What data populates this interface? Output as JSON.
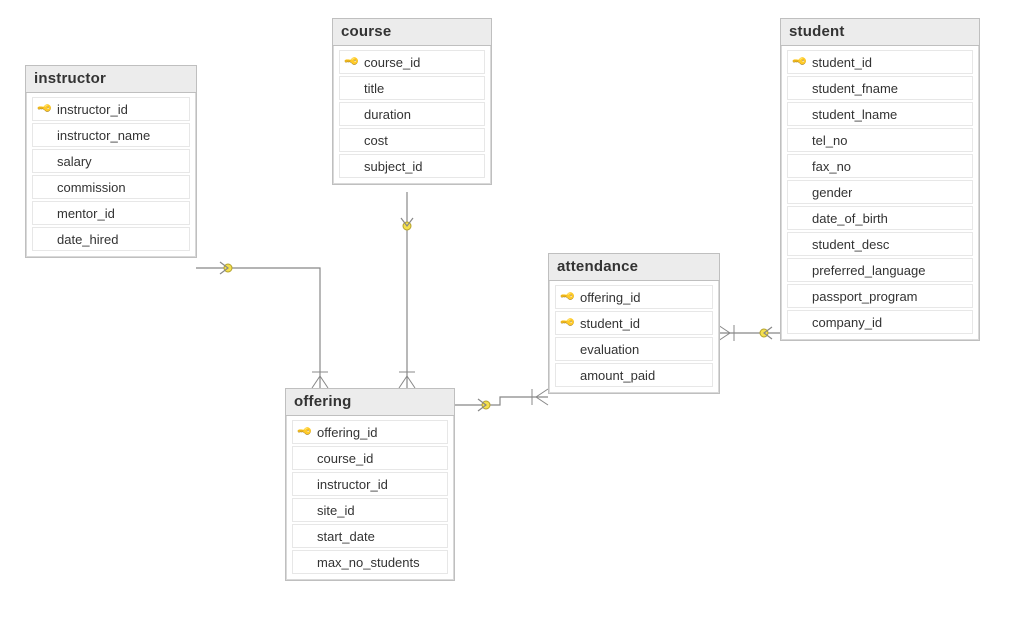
{
  "entities": {
    "instructor": {
      "title": "instructor",
      "columns": [
        {
          "name": "instructor_id",
          "pk": true
        },
        {
          "name": "instructor_name",
          "pk": false
        },
        {
          "name": "salary",
          "pk": false
        },
        {
          "name": "commission",
          "pk": false
        },
        {
          "name": "mentor_id",
          "pk": false
        },
        {
          "name": "date_hired",
          "pk": false
        }
      ]
    },
    "course": {
      "title": "course",
      "columns": [
        {
          "name": "course_id",
          "pk": true
        },
        {
          "name": "title",
          "pk": false
        },
        {
          "name": "duration",
          "pk": false
        },
        {
          "name": "cost",
          "pk": false
        },
        {
          "name": "subject_id",
          "pk": false
        }
      ]
    },
    "offering": {
      "title": "offering",
      "columns": [
        {
          "name": "offering_id",
          "pk": true
        },
        {
          "name": "course_id",
          "pk": false
        },
        {
          "name": "instructor_id",
          "pk": false
        },
        {
          "name": "site_id",
          "pk": false
        },
        {
          "name": "start_date",
          "pk": false
        },
        {
          "name": "max_no_students",
          "pk": false
        }
      ]
    },
    "attendance": {
      "title": "attendance",
      "columns": [
        {
          "name": "offering_id",
          "pk": true
        },
        {
          "name": "student_id",
          "pk": true
        },
        {
          "name": "evaluation",
          "pk": false
        },
        {
          "name": "amount_paid",
          "pk": false
        }
      ]
    },
    "student": {
      "title": "student",
      "columns": [
        {
          "name": "student_id",
          "pk": true
        },
        {
          "name": "student_fname",
          "pk": false
        },
        {
          "name": "student_lname",
          "pk": false
        },
        {
          "name": "tel_no",
          "pk": false
        },
        {
          "name": "fax_no",
          "pk": false
        },
        {
          "name": "gender",
          "pk": false
        },
        {
          "name": "date_of_birth",
          "pk": false
        },
        {
          "name": "student_desc",
          "pk": false
        },
        {
          "name": "preferred_language",
          "pk": false
        },
        {
          "name": "passport_program",
          "pk": false
        },
        {
          "name": "company_id",
          "pk": false
        }
      ]
    }
  },
  "relationships": [
    {
      "from": "course.course_id",
      "to": "offering.course_id",
      "type": "one-to-many"
    },
    {
      "from": "instructor.instructor_id",
      "to": "offering.instructor_id",
      "type": "one-to-many"
    },
    {
      "from": "offering.offering_id",
      "to": "attendance.offering_id",
      "type": "one-to-many"
    },
    {
      "from": "student.student_id",
      "to": "attendance.student_id",
      "type": "one-to-many"
    }
  ]
}
